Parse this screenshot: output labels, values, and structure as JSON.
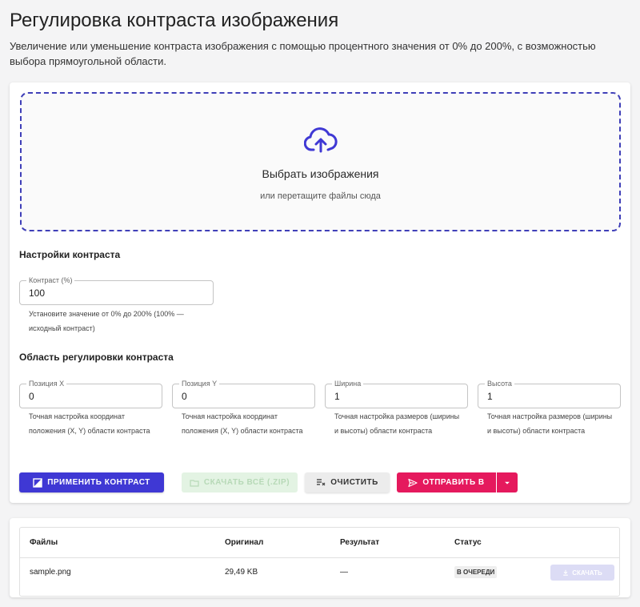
{
  "page": {
    "title": "Регулировка контраста изображения",
    "description": "Увеличение или уменьшение контраста изображения с помощью процентного значения от 0% до 200%, с возможностью выбора прямоугольной области."
  },
  "dropzone": {
    "icon": "cloud-upload-icon",
    "title": "Выбрать изображения",
    "subtitle": "или перетащите файлы сюда"
  },
  "contrast_settings": {
    "title": "Настройки контраста",
    "contrast_field": {
      "label": "Контраст (%)",
      "value": "100",
      "helper": "Установите значение от 0% до 200% (100% — исходный контраст)"
    }
  },
  "region": {
    "title": "Область регулировки контраста",
    "fields": [
      {
        "label": "Позиция X",
        "value": "0",
        "helper": "Точная настройка координат положения (X, Y) области контраста"
      },
      {
        "label": "Позиция Y",
        "value": "0",
        "helper": "Точная настройка координат положения (X, Y) области контраста"
      },
      {
        "label": "Ширина",
        "value": "1",
        "helper": "Точная настройка размеров (ширины и высоты) области контраста"
      },
      {
        "label": "Высота",
        "value": "1",
        "helper": "Точная настройка размеров (ширины и высоты) области контраста"
      }
    ]
  },
  "actions": {
    "apply": "ПРИМЕНИТЬ КОНТРАСТ",
    "download_zip": "СКАЧАТЬ ВСЁ (.ZIP)",
    "clear": "ОЧИСТИТЬ",
    "send": "ОТПРАВИТЬ В"
  },
  "files_table": {
    "columns": [
      "Файлы",
      "Оригинал",
      "Результат",
      "Статус"
    ],
    "rows": [
      {
        "name": "sample.png",
        "original": "29,49 KB",
        "result": "—",
        "status": "В ОЧЕРЕДИ",
        "download": "СКАЧАТЬ"
      }
    ]
  },
  "colors": {
    "primary": "#3f38d4",
    "dropzone_border": "#3f3fb8",
    "send": "#e5195d",
    "zip_disabled": "#e3f3e3"
  }
}
